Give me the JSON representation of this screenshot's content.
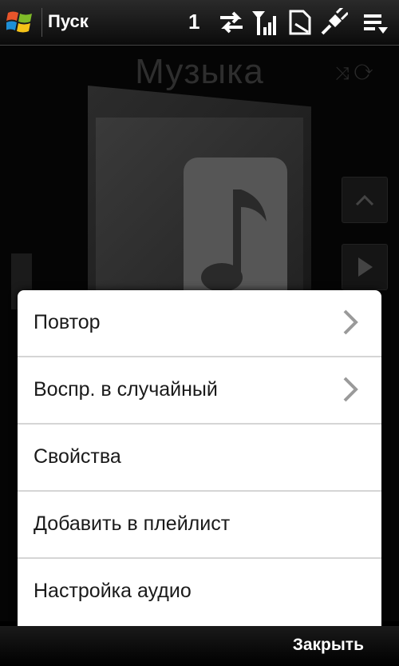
{
  "status_bar": {
    "start_label": "Пуск",
    "notification_count": "1"
  },
  "app": {
    "title": "Музыка"
  },
  "menu": {
    "items": [
      {
        "label": "Повтор",
        "has_submenu": true
      },
      {
        "label": "Воспр. в случайный",
        "has_submenu": true
      },
      {
        "label": "Свойства",
        "has_submenu": false
      },
      {
        "label": "Добавить в плейлист",
        "has_submenu": false
      },
      {
        "label": "Настройка аудио",
        "has_submenu": false
      }
    ]
  },
  "bottom_bar": {
    "close_label": "Закрыть"
  },
  "icons": [
    "windows-logo-icon",
    "sync-arrows-icon",
    "signal-icon",
    "sim-card-icon",
    "power-plug-icon",
    "menu-list-icon",
    "music-note-icon",
    "chevron-up-icon",
    "play-icon",
    "chevron-right-icon"
  ]
}
